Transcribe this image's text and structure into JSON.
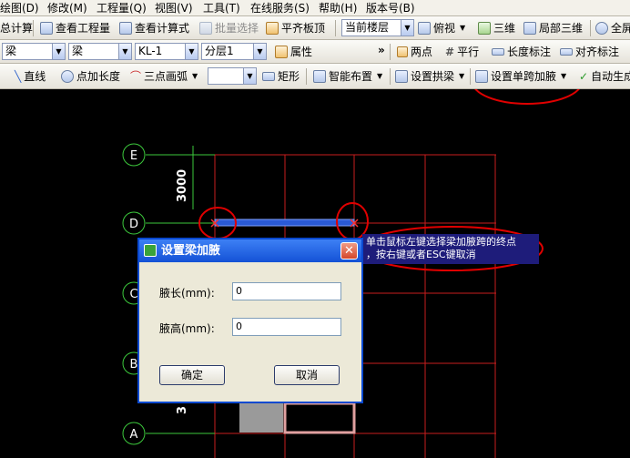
{
  "menubar": {
    "items": [
      "绘图(D)",
      "修改(M)",
      "工程量(Q)",
      "视图(V)",
      "工具(T)",
      "在线服务(S)",
      "帮助(H)",
      "版本号(B)"
    ]
  },
  "toolbar1": {
    "calc_partial": "总计算",
    "view_quantity": "查看工程量",
    "view_formula": "查看计算式",
    "batch_select": "批量选择",
    "flush_slab_top": "平齐板顶",
    "floor_select": "当前楼层",
    "view_mode": "俯视",
    "three_d": "三维",
    "local_3d": "局部三维",
    "full_screen": "全屏"
  },
  "toolbar2": {
    "category": "梁",
    "type": "梁",
    "element": "KL-1",
    "layer": "分层1",
    "properties": "属性",
    "overflow": "»",
    "two_points": "两点",
    "parallel": "平行",
    "length_dim": "长度标注",
    "align_dim": "对齐标注"
  },
  "toolbar3": {
    "line": "直线",
    "point_length": "点加长度",
    "three_point_arc": "三点画弧",
    "arc_combo": "",
    "rectangle": "矩形",
    "smart_place": "智能布置",
    "set_arch": "设置拱梁",
    "set_single_haunch": "设置单跨加腋",
    "auto_generate": "自动生成"
  },
  "canvas": {
    "axis_labels": [
      "E",
      "D",
      "C",
      "B",
      "A"
    ],
    "dim_text_1": "3000",
    "dim_text_2": "3"
  },
  "tooltip": {
    "line1": "单击鼠标左键选择梁加腋跨的终点",
    "line2": "，按右键或者ESC键取消"
  },
  "dialog": {
    "title": "设置梁加腋",
    "close": "✕",
    "haunch_length_label": "腋长(mm):",
    "haunch_length_value": "0",
    "haunch_height_label": "腋高(mm):",
    "haunch_height_value": "0",
    "ok": "确定",
    "cancel": "取消"
  },
  "colors": {
    "grid": "#c81e1e",
    "axis_green": "#3cc83c",
    "beam": "#2a5ad6",
    "annotation": "#e00000"
  }
}
